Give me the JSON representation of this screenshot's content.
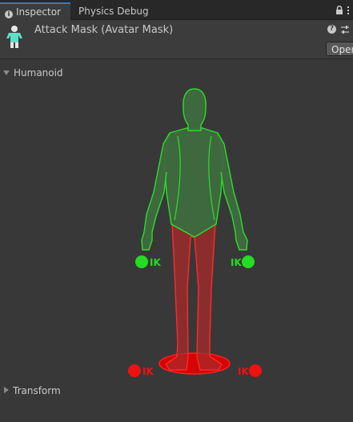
{
  "tabs": {
    "inspector": "Inspector",
    "physics_debug": "Physics Debug"
  },
  "header": {
    "title": "Attack Mask (Avatar Mask)",
    "help_glyph": "?",
    "open_button": "Open"
  },
  "sections": {
    "humanoid": "Humanoid",
    "transform": "Transform"
  },
  "ik_labels": {
    "left_hand": "IK",
    "right_hand": "IK",
    "left_foot": "IK",
    "right_foot": "IK"
  },
  "colors": {
    "enabled": "#22dd22",
    "disabled": "#ee1111"
  },
  "body_parts": {
    "upper_body": "enabled",
    "head": "enabled",
    "left_arm": "enabled",
    "right_arm": "enabled",
    "left_hand_ik": "enabled",
    "right_hand_ik": "enabled",
    "legs": "disabled",
    "root": "disabled",
    "left_foot_ik": "disabled",
    "right_foot_ik": "disabled"
  }
}
